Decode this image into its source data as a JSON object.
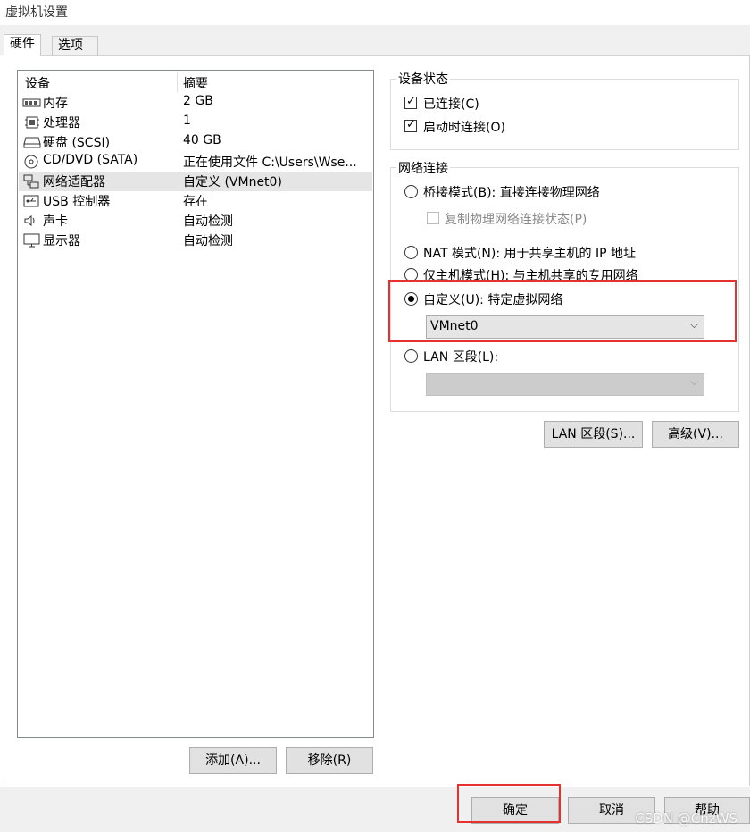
{
  "window": {
    "title": "虚拟机设置"
  },
  "tabs": [
    {
      "label": "硬件",
      "active": true
    },
    {
      "label": "选项",
      "active": false
    }
  ],
  "device_table": {
    "headers": [
      "设备",
      "摘要"
    ],
    "rows": [
      {
        "icon": "memory-icon",
        "name": "内存",
        "summary": "2 GB"
      },
      {
        "icon": "cpu-icon",
        "name": "处理器",
        "summary": "1"
      },
      {
        "icon": "hard-disk-icon",
        "name": "硬盘 (SCSI)",
        "summary": "40 GB"
      },
      {
        "icon": "cd-dvd-icon",
        "name": "CD/DVD (SATA)",
        "summary": "正在使用文件 C:\\Users\\Wse..."
      },
      {
        "icon": "network-adapter-icon",
        "name": "网络适配器",
        "summary": "自定义 (VMnet0)",
        "selected": true
      },
      {
        "icon": "usb-icon",
        "name": "USB 控制器",
        "summary": "存在"
      },
      {
        "icon": "sound-card-icon",
        "name": "声卡",
        "summary": "自动检测"
      },
      {
        "icon": "monitor-icon",
        "name": "显示器",
        "summary": "自动检测"
      }
    ]
  },
  "device_buttons": {
    "add": "添加(A)...",
    "remove": "移除(R)"
  },
  "device_status": {
    "title": "设备状态",
    "connected": {
      "label": "已连接(C)",
      "checked": true
    },
    "connect_at_power_on": {
      "label": "启动时连接(O)",
      "checked": true
    }
  },
  "network_connection": {
    "title": "网络连接",
    "bridged": {
      "label": "桥接模式(B): 直接连接物理网络",
      "selected": false
    },
    "replicate": {
      "label": "复制物理网络连接状态(P)",
      "checked": false
    },
    "nat": {
      "label": "NAT 模式(N): 用于共享主机的 IP 地址",
      "selected": false
    },
    "host_only": {
      "label": "仅主机模式(H): 与主机共享的专用网络",
      "selected": false
    },
    "custom": {
      "label": "自定义(U): 特定虚拟网络",
      "selected": true,
      "value": "VMnet0"
    },
    "lan_segment": {
      "label": "LAN 区段(L):",
      "selected": false,
      "value": ""
    }
  },
  "network_buttons": {
    "lan_segments": "LAN 区段(S)...",
    "advanced": "高级(V)..."
  },
  "dialog_buttons": {
    "ok": "确定",
    "cancel": "取消",
    "help": "帮助"
  },
  "watermark": "CSDN @CnzWS",
  "colors": {
    "highlight_box": "#e6322e",
    "selected_row": "#e5e5e5",
    "button_face": "#e1e1e1"
  }
}
